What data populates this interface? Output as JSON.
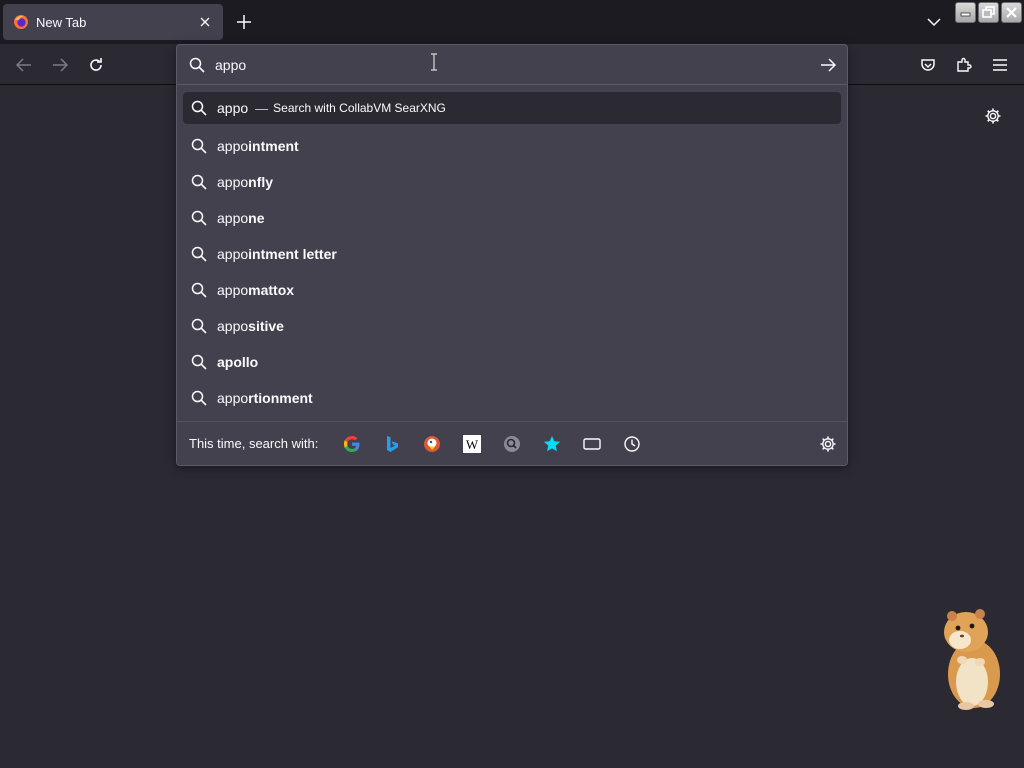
{
  "tab": {
    "title": "New Tab"
  },
  "urlbar": {
    "value": "appo",
    "placeholder": ""
  },
  "suggestions": {
    "heuristic": {
      "typed": "appo",
      "dash": "—",
      "action": "Search with CollabVM SearXNG"
    },
    "items": [
      {
        "prefix": "appo",
        "bold": "intment"
      },
      {
        "prefix": "appo",
        "bold": "nfly"
      },
      {
        "prefix": "appo",
        "bold": "ne"
      },
      {
        "prefix": "appo",
        "bold": "intment letter"
      },
      {
        "prefix": "appo",
        "bold": "mattox"
      },
      {
        "prefix": "appo",
        "bold": "sitive"
      },
      {
        "prefix": "",
        "bold": "apollo"
      },
      {
        "prefix": "appo",
        "bold": "rtionment"
      }
    ]
  },
  "oneoff": {
    "label": "This time, search with:",
    "engines": [
      "google-icon",
      "bing-icon",
      "duckduckgo-icon",
      "wikipedia-icon",
      "searxng-icon",
      "bookmarks-icon",
      "tabs-icon",
      "history-icon"
    ]
  },
  "colors": {
    "window_bg": "#1c1b22",
    "toolbar_bg": "#2b2a33",
    "popup_bg": "#42414d",
    "text": "#fbfbfe"
  }
}
